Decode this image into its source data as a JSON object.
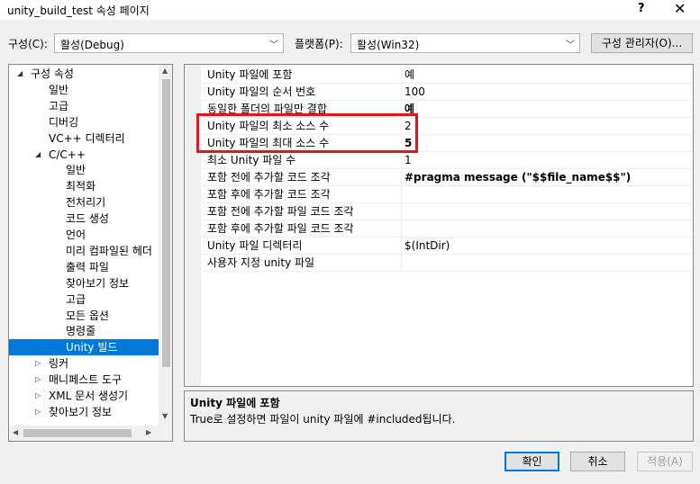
{
  "window": {
    "title": "unity_build_test 속성 페이지",
    "help_glyph": "?",
    "close_glyph": "✕"
  },
  "toolbar": {
    "config_label": "구성(C):",
    "config_value": "활성(Debug)",
    "platform_label": "플랫폼(P):",
    "platform_value": "활성(Win32)",
    "config_manager_label": "구성 관리자(O)..."
  },
  "tree": {
    "items": [
      {
        "label": "구성 속성",
        "expander": "◢"
      },
      {
        "label": "일반"
      },
      {
        "label": "고급"
      },
      {
        "label": "디버깅"
      },
      {
        "label": "VC++ 디렉터리"
      },
      {
        "label": "C/C++",
        "expander": "◢"
      },
      {
        "label": "일반"
      },
      {
        "label": "최적화"
      },
      {
        "label": "전처리기"
      },
      {
        "label": "코드 생성"
      },
      {
        "label": "언어"
      },
      {
        "label": "미리 컴파일된 헤더"
      },
      {
        "label": "출력 파일"
      },
      {
        "label": "찾아보기 정보"
      },
      {
        "label": "고급"
      },
      {
        "label": "모든 옵션"
      },
      {
        "label": "명령줄"
      },
      {
        "label": "Unity 빌드",
        "selected": true
      },
      {
        "label": "링커",
        "expander": "▷"
      },
      {
        "label": "매니페스트 도구",
        "expander": "▷"
      },
      {
        "label": "XML 문서 생성기",
        "expander": "▷"
      },
      {
        "label": "찾아보기 정보",
        "expander": "▷"
      }
    ]
  },
  "properties": [
    {
      "name": "Unity 파일에 포함",
      "value": "예",
      "bold": false
    },
    {
      "name": "Unity 파일의 순서 번호",
      "value": "100",
      "bold": false
    },
    {
      "name": "동일한 폴더의 파일만 결합",
      "value": "예",
      "bold": true
    },
    {
      "name": "Unity 파일의 최소 소스 수",
      "value": "2",
      "bold": false
    },
    {
      "name": "Unity 파일의 최대 소스 수",
      "value": "5",
      "bold": true
    },
    {
      "name": "최소 Unity 파일 수",
      "value": "1",
      "bold": false
    },
    {
      "name": "포함 전에 추가할 코드 조각",
      "value": "#pragma message (\"$$file_name$$\")",
      "bold": true
    },
    {
      "name": "포함 후에 추가할 코드 조각",
      "value": "",
      "bold": false
    },
    {
      "name": "포함 전에 추가할 파일 코드 조각",
      "value": "",
      "bold": false
    },
    {
      "name": "포함 후에 추가할 파일 코드 조각",
      "value": "",
      "bold": false
    },
    {
      "name": "Unity 파일 디렉터리",
      "value": "$(IntDir)",
      "bold": false
    },
    {
      "name": "사용자 지정 unity 파일",
      "value": "",
      "bold": false
    }
  ],
  "description": {
    "title": "Unity 파일에 포함",
    "text": "True로 설정하면 파일이 unity 파일에 #included됩니다."
  },
  "buttons": {
    "ok": "확인",
    "cancel": "취소",
    "apply": "적용(A)"
  },
  "colors": {
    "highlight_border": "#e0161e",
    "selection": "#0078d7"
  }
}
